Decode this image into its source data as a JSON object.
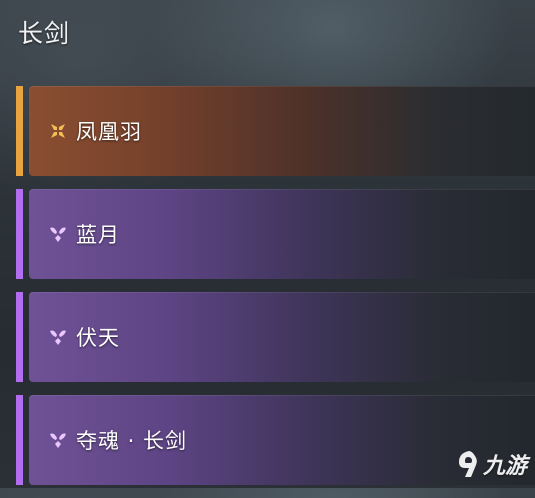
{
  "category": {
    "title": "长剑"
  },
  "weapons": [
    {
      "name": "凤凰羽",
      "rarity_color": "#e9a33f",
      "icon": "orange-quad-petal-icon"
    },
    {
      "name": "蓝月",
      "rarity_color": "#b36df0",
      "icon": "purple-tri-petal-icon"
    },
    {
      "name": "伏天",
      "rarity_color": "#b36df0",
      "icon": "purple-tri-petal-icon"
    },
    {
      "name": "夺魂 · 长剑",
      "rarity_color": "#b36df0",
      "icon": "purple-tri-petal-icon"
    }
  ],
  "watermark": {
    "text": "九游"
  }
}
